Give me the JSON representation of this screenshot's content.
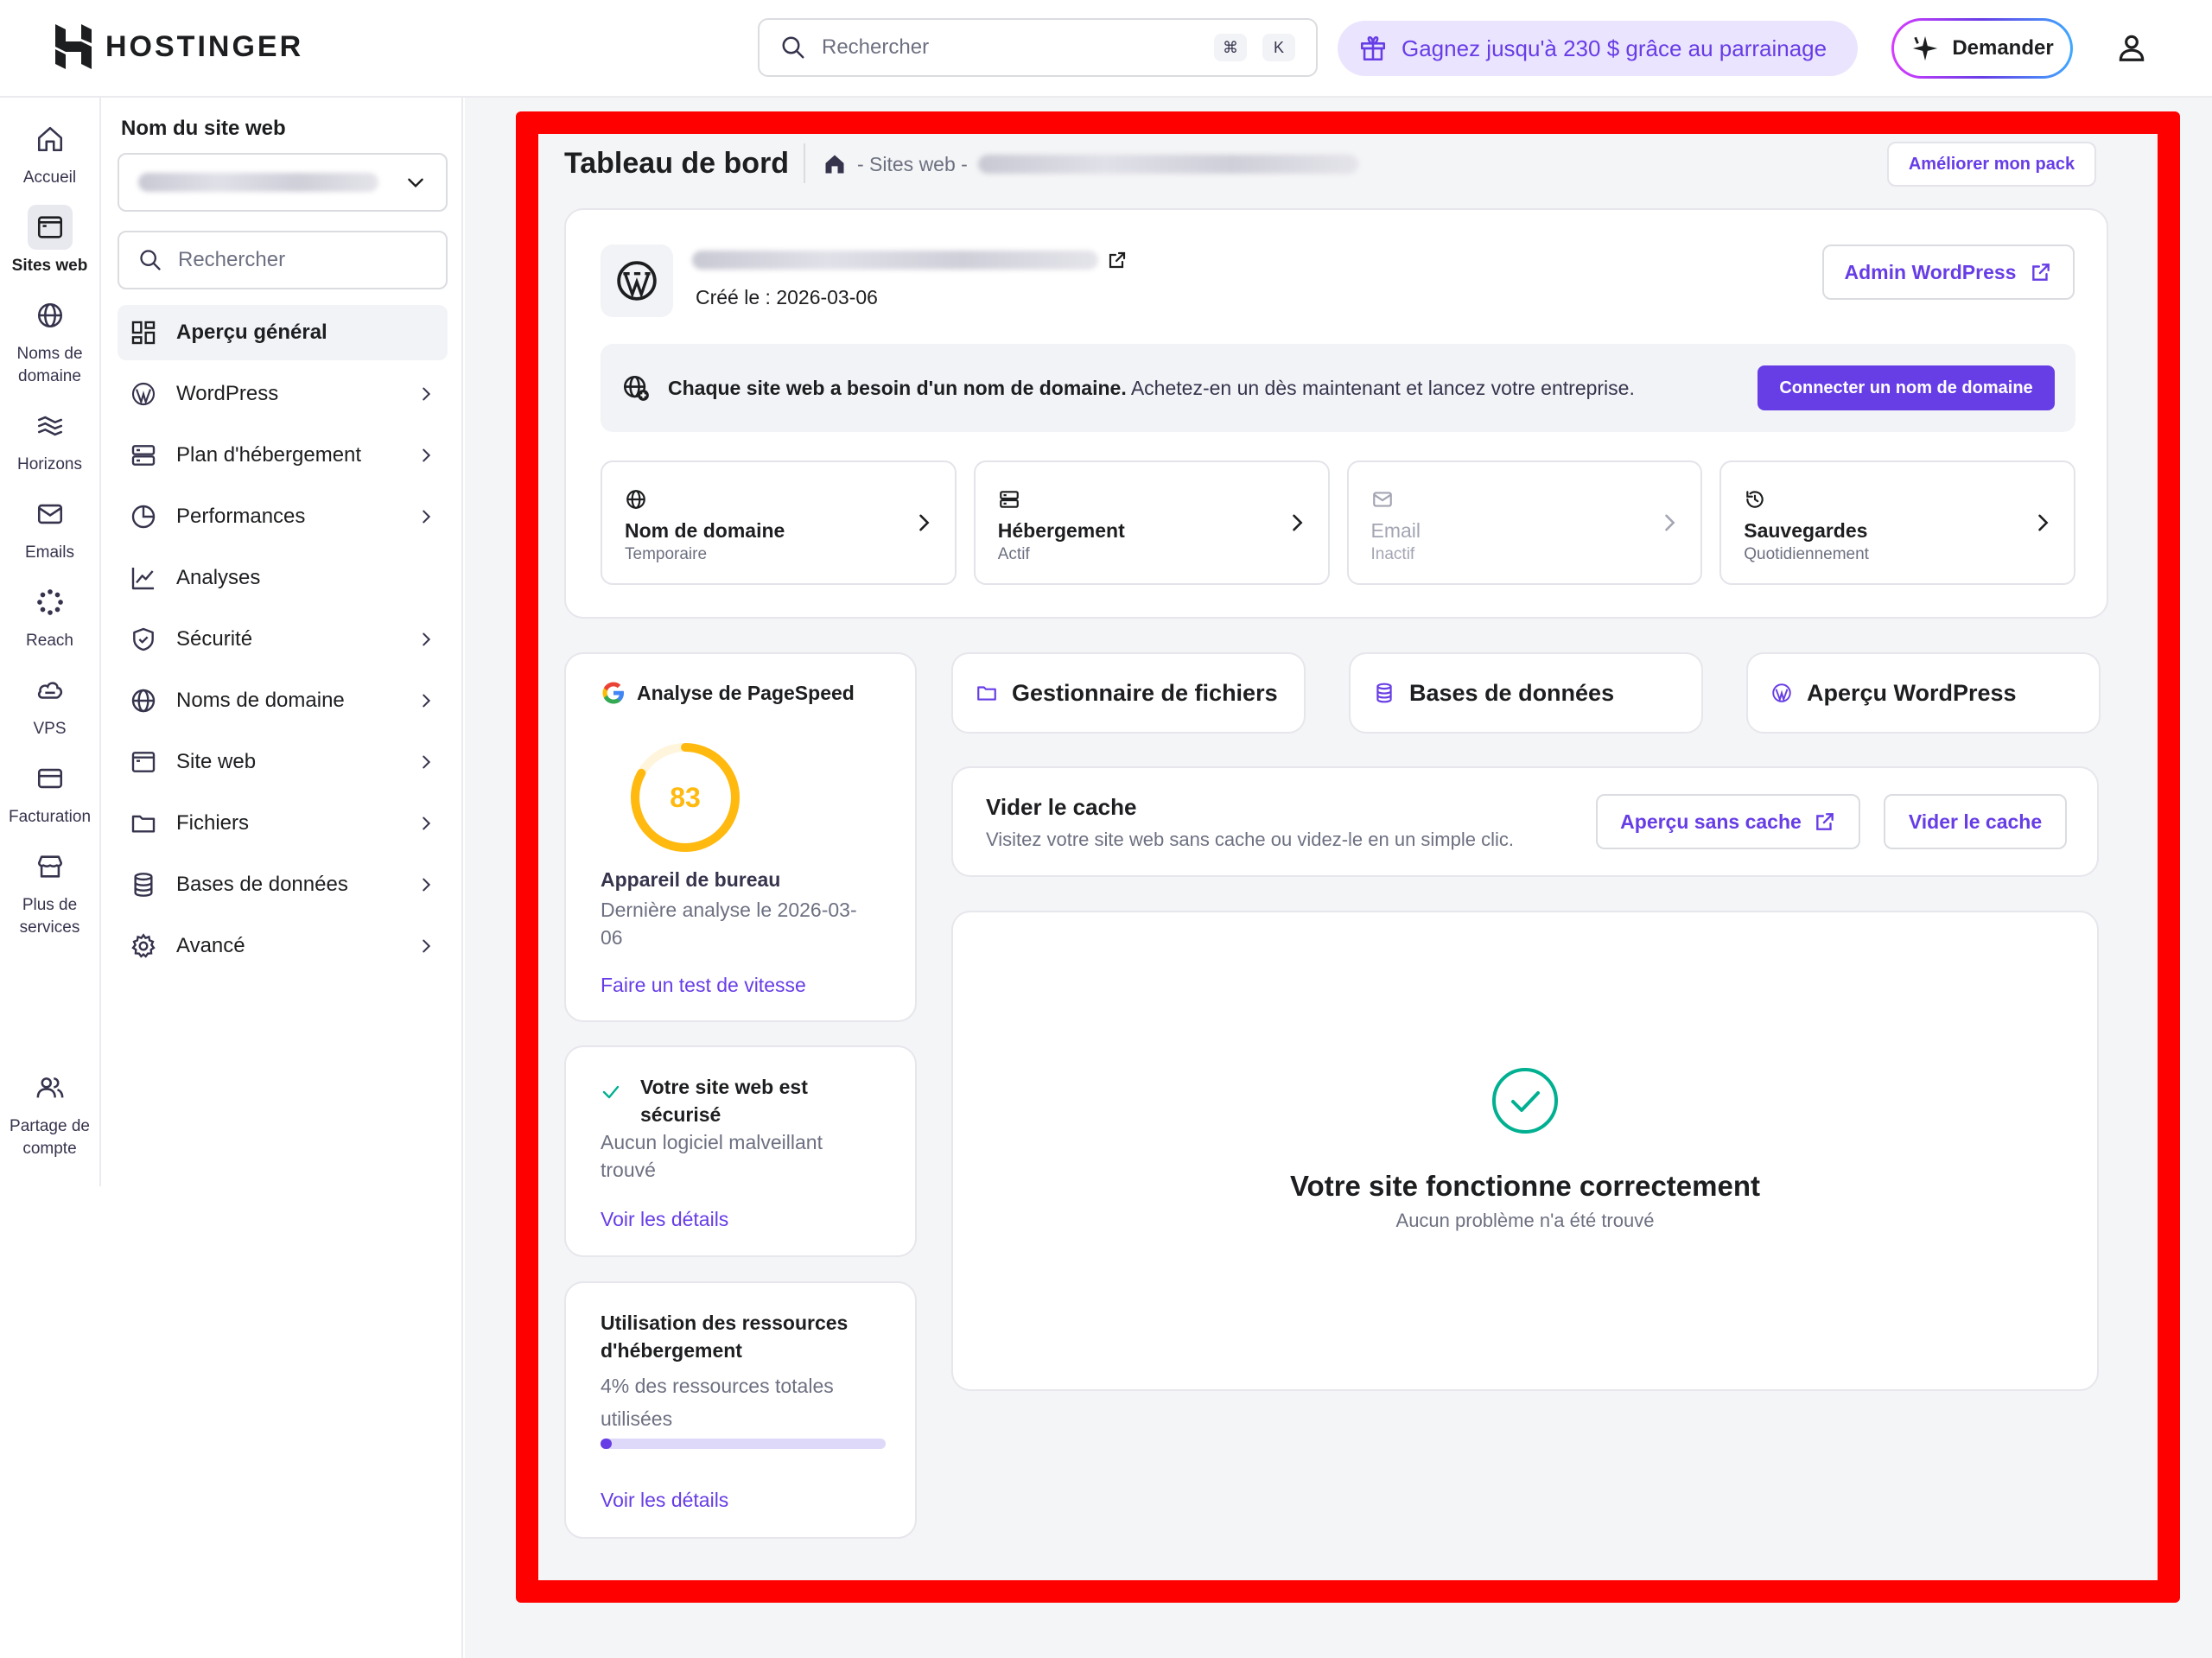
{
  "brand": {
    "name": "HOSTINGER"
  },
  "topbar": {
    "search_placeholder": "Rechercher",
    "shortcut_cmd": "⌘",
    "shortcut_key": "K",
    "referral_text": "Gagnez jusqu'à 230 $ grâce au parrainage",
    "ask_label": "Demander"
  },
  "rail": {
    "items": [
      {
        "label": "Accueil",
        "icon": "home-icon"
      },
      {
        "label": "Sites web",
        "icon": "website-icon",
        "active": true
      },
      {
        "label": "Noms de domaine",
        "icon": "globe-icon"
      },
      {
        "label": "Horizons",
        "icon": "horizons-icon"
      },
      {
        "label": "Emails",
        "icon": "mail-icon"
      },
      {
        "label": "Reach",
        "icon": "reach-icon"
      },
      {
        "label": "VPS",
        "icon": "cloud-icon"
      },
      {
        "label": "Facturation",
        "icon": "card-icon"
      },
      {
        "label": "Plus de services",
        "icon": "store-icon"
      },
      {
        "label": "Partage de compte",
        "icon": "users-icon"
      }
    ]
  },
  "sidebar": {
    "title": "Nom du site web",
    "search_placeholder": "Rechercher",
    "items": [
      {
        "label": "Aperçu général",
        "icon": "dashboard-icon",
        "active": true
      },
      {
        "label": "WordPress",
        "icon": "wordpress-icon",
        "chevron": true
      },
      {
        "label": "Plan d'hébergement",
        "icon": "server-icon",
        "chevron": true
      },
      {
        "label": "Performances",
        "icon": "pie-chart-icon",
        "chevron": true
      },
      {
        "label": "Analyses",
        "icon": "trend-icon"
      },
      {
        "label": "Sécurité",
        "icon": "shield-icon",
        "chevron": true
      },
      {
        "label": "Noms de domaine",
        "icon": "globe-icon",
        "chevron": true
      },
      {
        "label": "Site web",
        "icon": "browser-icon",
        "chevron": true
      },
      {
        "label": "Fichiers",
        "icon": "folder-icon",
        "chevron": true
      },
      {
        "label": "Bases de données",
        "icon": "database-icon",
        "chevron": true
      },
      {
        "label": "Avancé",
        "icon": "gear-icon",
        "chevron": true
      }
    ]
  },
  "header": {
    "title": "Tableau de bord",
    "breadcrumb": "- Sites web -",
    "upgrade_label": "Améliorer mon pack"
  },
  "site": {
    "created": "Créé le : 2026-03-06",
    "wp_admin_label": "Admin WordPress",
    "banner_bold": "Chaque site web a besoin d'un nom de domaine.",
    "banner_text": "Achetez-en un dès maintenant et lancez votre entreprise.",
    "connect_label": "Connecter un nom de domaine",
    "tiles": [
      {
        "name": "Nom de domaine",
        "status": "Temporaire",
        "icon": "globe-icon"
      },
      {
        "name": "Hébergement",
        "status": "Actif",
        "icon": "server-icon"
      },
      {
        "name": "Email",
        "status": "Inactif",
        "icon": "mail-icon",
        "disabled": true
      },
      {
        "name": "Sauvegardes",
        "status": "Quotidiennement",
        "icon": "history-icon"
      }
    ]
  },
  "pagespeed": {
    "title": "Analyse de PageSpeed",
    "score": 83,
    "score_text": "83",
    "score_color": "#ffb90f",
    "device": "Appareil de bureau",
    "last_run": "Dernière analyse le 2026-03-06",
    "link": "Faire un test de vitesse"
  },
  "security": {
    "title": "Votre site web est sécurisé",
    "subtitle": "Aucun logiciel malveillant trouvé",
    "link": "Voir les détails"
  },
  "resources": {
    "title": "Utilisation des ressources d'hébergement",
    "subtitle": "4% des ressources totales utilisées",
    "usage_percent": 4,
    "link": "Voir les détails"
  },
  "quick_actions": [
    {
      "label": "Gestionnaire de fichiers",
      "icon": "folder-icon"
    },
    {
      "label": "Bases de données",
      "icon": "database-icon"
    },
    {
      "label": "Aperçu WordPress",
      "icon": "wordpress-icon"
    }
  ],
  "cache": {
    "title": "Vider le cache",
    "subtitle": "Visitez votre site web sans cache ou videz-le en un simple clic.",
    "preview_label": "Aperçu sans cache",
    "clear_label": "Vider le cache"
  },
  "status": {
    "title": "Votre site fonctionne correctement",
    "subtitle": "Aucun problème n'a été trouvé"
  },
  "colors": {
    "accent": "#673de6",
    "success": "#00b090",
    "highlight_frame": "#fe0000"
  }
}
